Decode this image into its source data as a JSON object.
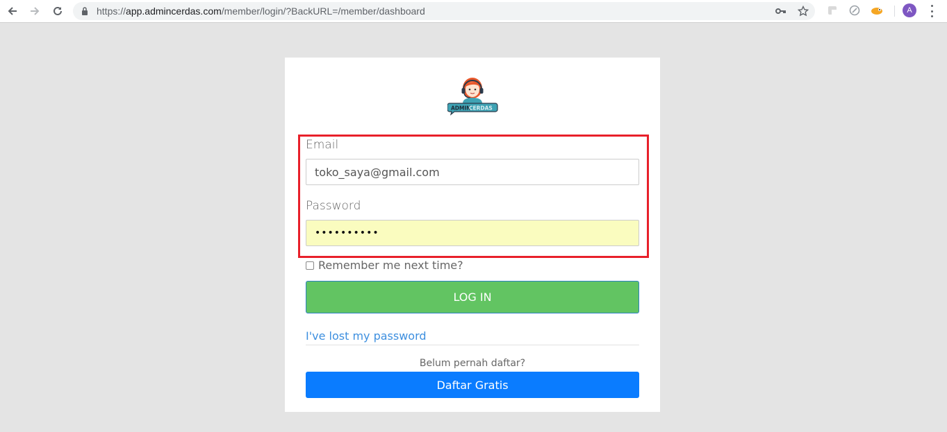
{
  "browser": {
    "url_prefix": "https://",
    "url_host": "app.admincerdas.com",
    "url_path": "/member/login/?BackURL=/member/dashboard",
    "profile_initial": "A",
    "avatar_color": "#7e57c2"
  },
  "login": {
    "email_label": "Email",
    "email_value": "toko_saya@gmail.com",
    "password_label": "Password",
    "password_value": "••••••••••",
    "remember_label": "Remember me next time?",
    "login_button": "LOG IN",
    "lost_password_link": "I've lost my password",
    "signup_prompt": "Belum pernah daftar?",
    "signup_button": "Daftar Gratis"
  },
  "logo": {
    "text_part1": "ADMIN",
    "text_part2": "CERDAS"
  },
  "colors": {
    "login_button": "#62c462",
    "signup_button": "#0a7cff",
    "highlight_border": "#e8202a",
    "link": "#3d8fdf",
    "autofill_bg": "#fafcbf"
  }
}
